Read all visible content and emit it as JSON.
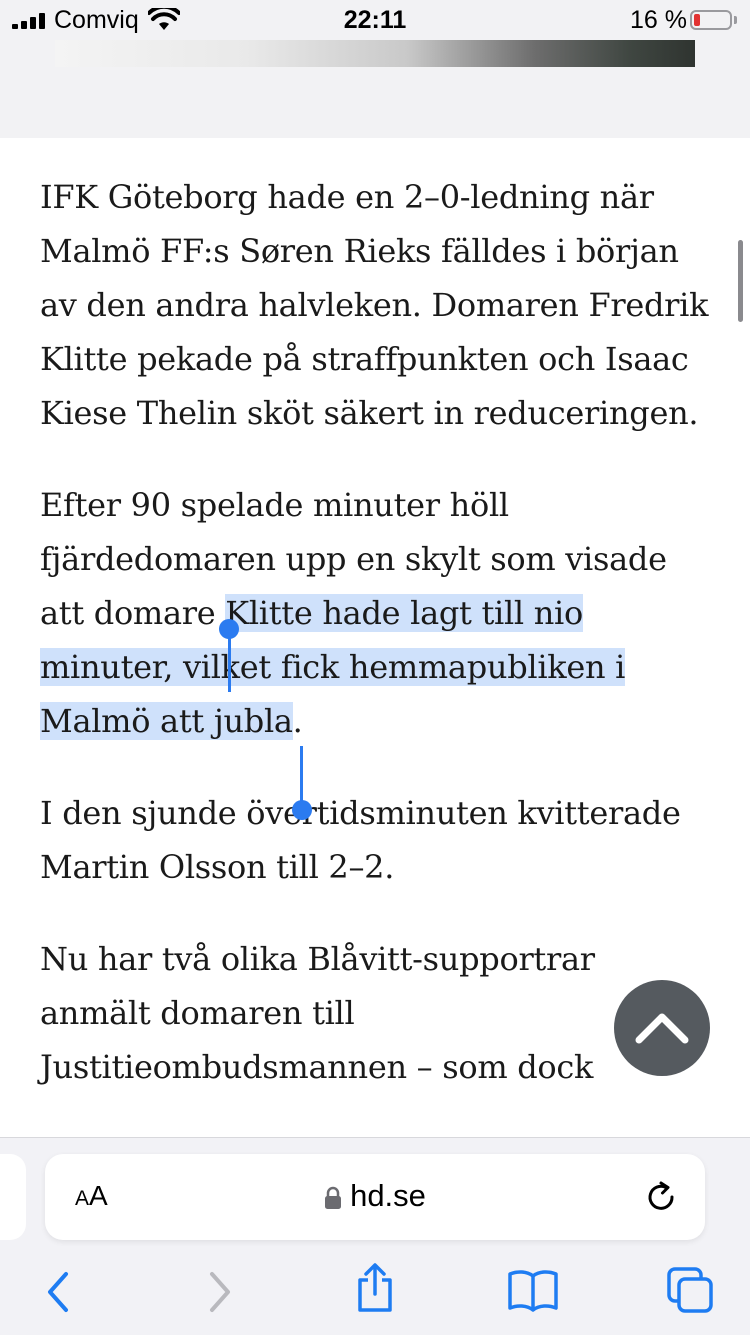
{
  "status_bar": {
    "carrier": "Comviq",
    "time": "22:11",
    "battery_percent": "16 %",
    "battery_level": 0.16,
    "accent_low_battery": "#e23232"
  },
  "article": {
    "paragraphs": [
      "IFK Göteborg hade en 2–0-ledning när Malmö FF:s Søren Rieks fälldes i början av den andra halvleken. Domaren Fredrik Klitte pekade på straffpunkten och Isaac Kiese Thelin sköt säkert in reduceringen.",
      {
        "before": "Efter 90 spelade minuter höll fjärdedomaren upp en skylt som visade att domare ",
        "selected": "Klitte hade lagt till nio minuter, vilket fick hemmapubliken i Malmö att jubla",
        "after": "."
      },
      "I den sjunde övertidsminuten kvitterade Martin Olsson till 2–2.",
      "Nu har två olika Blåvitt-supportrar anmält domaren till Justitieombudsmannen – som dock"
    ],
    "selection_color": "#cfe1fb",
    "handle_color": "#2b7bf0"
  },
  "scroll_top_button": {
    "icon": "chevron-up-icon"
  },
  "toolbar": {
    "aa_label_small": "A",
    "aa_label_large": "A",
    "url": "hd.se",
    "icons": {
      "lock": "lock-icon",
      "reload": "reload-icon",
      "back": "back-icon",
      "forward": "forward-icon",
      "share": "share-icon",
      "bookmarks": "bookmarks-icon",
      "tabs": "tabs-icon"
    },
    "accent": "#1e7cf2"
  }
}
